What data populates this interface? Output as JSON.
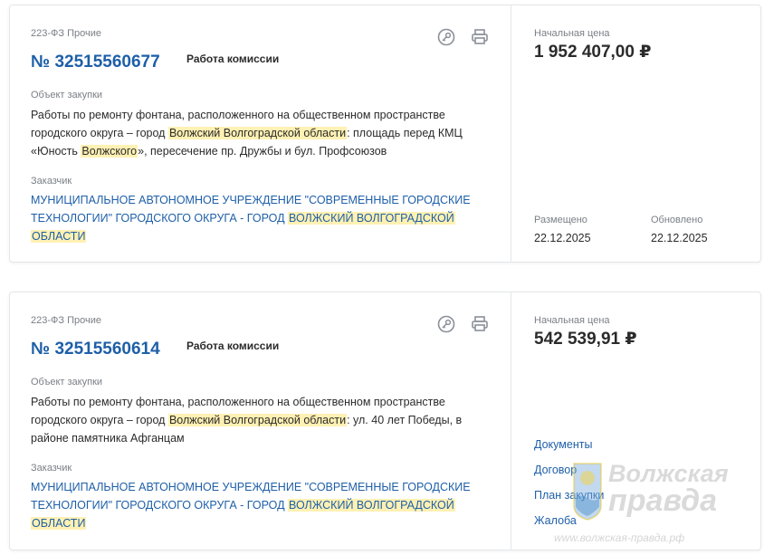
{
  "cards": [
    {
      "law_type": "223-ФЗ Прочие",
      "number": "№ 32515560677",
      "stage": "Работа комиссии",
      "object_label": "Объект закупки",
      "description": {
        "line1": "Работы по ремонту фонтана, расположенного на общественном пространстве",
        "line2_pre": "городского округа – город ",
        "line2_hl": "Волжский Волгоградской области",
        "line2_post": ": площадь перед КМЦ",
        "line3_pre": "«Юность ",
        "line3_hl": "Волжского",
        "line3_post": "», пересечение пр. Дружбы и бул. Профсоюзов"
      },
      "customer_label": "Заказчик",
      "customer": {
        "line1": "МУНИЦИПАЛЬНОЕ АВТОНОМНОЕ УЧРЕЖДЕНИЕ \"СОВРЕМЕННЫЕ ГОРОДСКИЕ",
        "line2_pre": "ТЕХНОЛОГИИ\" ГОРОДСКОГО ОКРУГА - ГОРОД ",
        "line2_hl": "ВОЛЖСКИЙ ВОЛГОГРАДСКОЙ",
        "line3_hl": "ОБЛАСТИ"
      },
      "price_label": "Начальная цена",
      "price": "1 952 407,00 ₽",
      "posted_label": "Размещено",
      "posted": "22.12.2025",
      "updated_label": "Обновлено",
      "updated": "22.12.2025"
    },
    {
      "law_type": "223-ФЗ Прочие",
      "number": "№ 32515560614",
      "stage": "Работа комиссии",
      "object_label": "Объект закупки",
      "description": {
        "line1": "Работы по ремонту фонтана, расположенного на общественном пространстве",
        "line2_pre": "городского округа – город ",
        "line2_hl": "Волжский Волгоградской области",
        "line2_post": ": ул. 40 лет Победы, в",
        "line3": "районе памятника Афганцам"
      },
      "customer_label": "Заказчик",
      "customer": {
        "line1": "МУНИЦИПАЛЬНОЕ АВТОНОМНОЕ УЧРЕЖДЕНИЕ \"СОВРЕМЕННЫЕ ГОРОДСКИЕ",
        "line2_pre": "ТЕХНОЛОГИИ\" ГОРОДСКОГО ОКРУГА - ГОРОД ",
        "line2_hl": "ВОЛЖСКИЙ ВОЛГОГРАДСКОЙ",
        "line3_hl": "ОБЛАСТИ"
      },
      "price_label": "Начальная цена",
      "price": "542 539,91 ₽",
      "links": [
        "Документы",
        "Договор",
        "План закупки",
        "Жалоба"
      ]
    }
  ],
  "watermark": {
    "title_line1": "Волжская",
    "title_line2": "правда",
    "url": "www.волжская-правда.рф"
  },
  "colors": {
    "link": "#1e5fa8",
    "highlight": "#fff1b3",
    "muted": "#7a7f86",
    "border": "#e3e6ea"
  }
}
